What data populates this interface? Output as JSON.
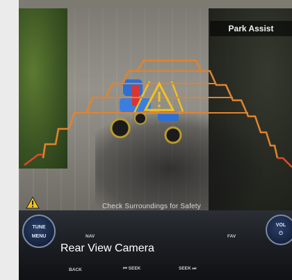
{
  "overlay": {
    "title": "Park Assist",
    "warning_text": "Check Surroundings for Safety"
  },
  "dashboard": {
    "left_knob_label": [
      "TUNE",
      "MENU"
    ],
    "right_knob_label": [
      "VOL",
      "⏻"
    ],
    "nav_label": "NAV",
    "fav_label": "FAV",
    "back_label": "BACK",
    "seek_back_label": "⏮ SEEK",
    "seek_forward_label": "SEEK ⏭"
  },
  "caption": "Rear View Camera",
  "colors": {
    "guideline_orange": "#e0832f",
    "guideline_yellow": "#f2c21a",
    "guideline_red": "#d94b2a"
  }
}
